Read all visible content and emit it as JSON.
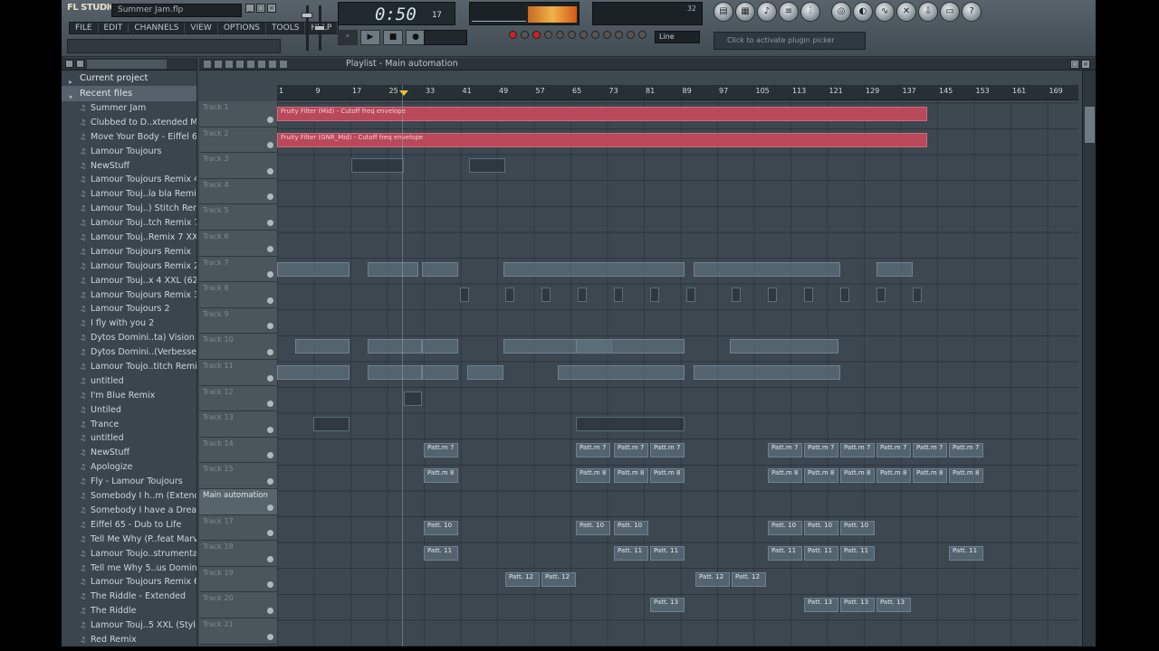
{
  "app": {
    "logo": "FL STUDIO",
    "project_file": "Summer Jam.flp"
  },
  "menu": [
    "FILE",
    "EDIT",
    "CHANNELS",
    "VIEW",
    "OPTIONS",
    "TOOLS",
    "HELP"
  ],
  "transport": {
    "time": "0:50",
    "time_small": "17",
    "pattern": "Line"
  },
  "hint": {
    "text": "Click to activate plugin picker"
  },
  "browser": {
    "sections": [
      "Current project",
      "Recent files"
    ],
    "files": [
      "Summer Jam",
      "Clubbed to D..xtended Mix)",
      "Move Your Body - Eiffel 65",
      "Lamour Toujours",
      "NewStuff",
      "Lamour Toujours Remix 4",
      "Lamour Touj..la bla Remix",
      "Lamour Touj..) Stitch Remix",
      "Lamour Touj..tch Remix 7",
      "Lamour Touj..Remix 7 XXL",
      "Lamour Toujours Remix",
      "Lamour Toujours Remix 2,2",
      "Lamour Touj..x 4 XXL (626",
      "Lamour Toujours Remix 3",
      "Lamour Toujours 2",
      "I fly with you 2",
      "Dytos Domini..ta) Vision 3",
      "Dytos Domini..(Verbessert)",
      "Lamour Toujo..titch Remix)",
      "untitled",
      "I'm Blue Remix",
      "Untiled",
      "Trance",
      "untitled",
      "NewStuff",
      "Apologize",
      "Fly - Lamour Toujours",
      "Somebody I h..m (Extended)",
      "Somebody I have a Dream",
      "Eiffel 65 - Dub to Life",
      "Tell Me Why (P..feat Marvin)",
      "Lamour Toujo..strumental)",
      "Tell me Why 5..us Dominik)",
      "Lamour Toujours Remix 6",
      "The Riddle - Extended",
      "The Riddle",
      "Lamour Touj..5 XXL (Stylr)",
      "Red Remix"
    ]
  },
  "playlist": {
    "title": "Playlist - Main automation",
    "ruler": [
      "1",
      "9",
      "17",
      "25",
      "33",
      "41",
      "49",
      "57",
      "65",
      "73",
      "81",
      "89",
      "97",
      "105",
      "113",
      "121",
      "129",
      "137",
      "145",
      "153",
      "161",
      "169"
    ],
    "tracks": [
      "Track 1",
      "Track 2",
      "Track 3",
      "Track 4",
      "Track 5",
      "Track 6",
      "Track 7",
      "Track 8",
      "Track 9",
      "Track 10",
      "Track 11",
      "Track 12",
      "Track 13",
      "Track 14",
      "Track 15",
      "Main automation",
      "Track 17",
      "Track 18",
      "Track 19",
      "Track 20",
      "Track 21"
    ],
    "auto_clips": [
      "Fruity Filter (Mid) - Cutoff freq envelope",
      "Fruity Filter (GNR_Mid) - Cutoff freq envelope"
    ],
    "pattern_labels": {
      "p7": "Patt.m 7",
      "p8": "Patt.m 8",
      "p10": "Patt. 10",
      "p11": "Patt. 11",
      "p12": "Patt. 12",
      "p13": "Patt. 13"
    }
  }
}
